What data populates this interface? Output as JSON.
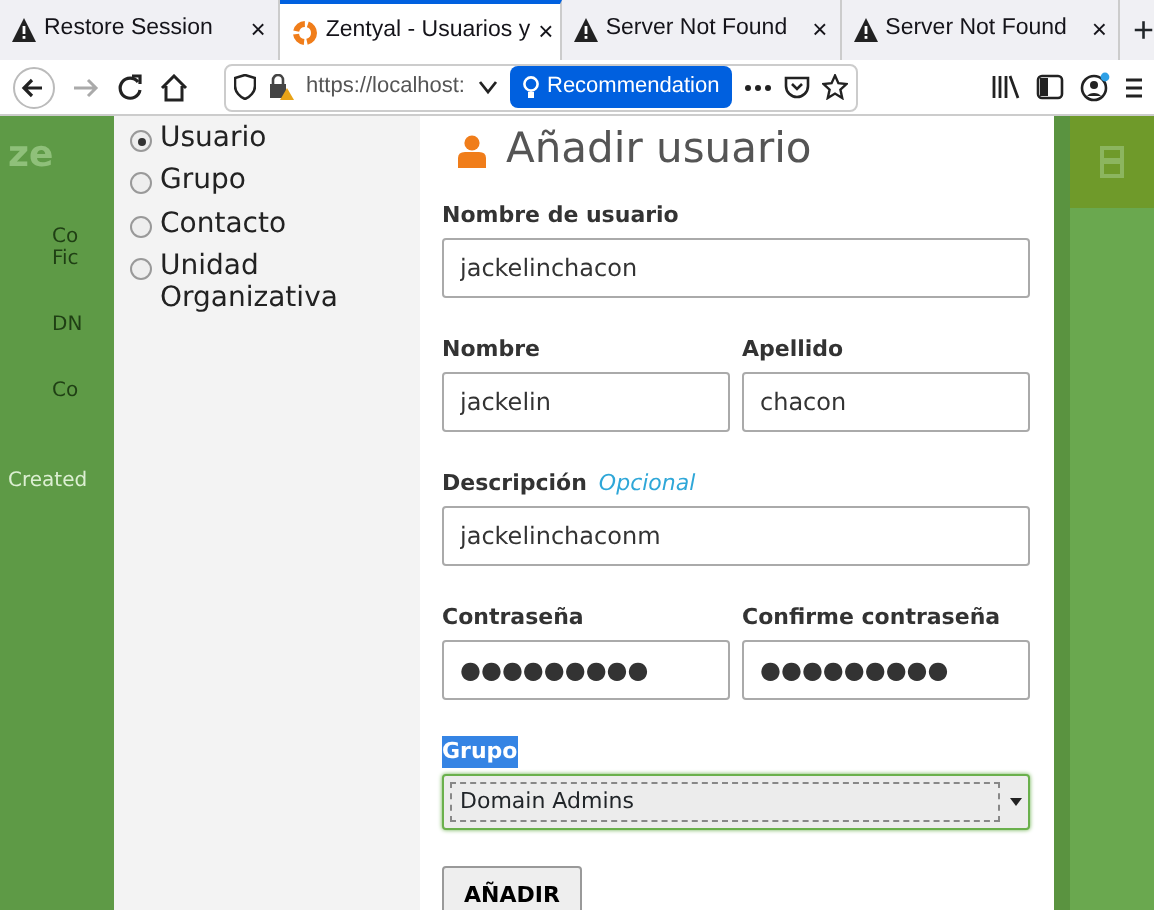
{
  "browser_tabs": [
    {
      "title": "Restore Session",
      "kind": "warning",
      "close": "×",
      "selected": false
    },
    {
      "title": "Zentyal - Usuarios y",
      "kind": "zentyal",
      "close": "×",
      "selected": true
    },
    {
      "title": "Server Not Found",
      "kind": "warning",
      "close": "×",
      "selected": false
    },
    {
      "title": "Server Not Found",
      "kind": "warning",
      "close": "×",
      "selected": false
    }
  ],
  "new_tab": "+",
  "address_bar": {
    "url": "https://localhost:",
    "recommendation": "Recommendation"
  },
  "forward_disabled": true,
  "background_sidebar": [
    {
      "text": "ze",
      "kind": "logo"
    },
    {
      "text": "Co\nFic",
      "kind": "item"
    },
    {
      "text": "DN",
      "kind": "item"
    },
    {
      "text": "Co",
      "kind": "item"
    },
    {
      "text": "Created",
      "kind": "footer"
    }
  ],
  "object_types": [
    {
      "label": "Usuario",
      "selected": true
    },
    {
      "label": "Grupo",
      "selected": false
    },
    {
      "label": "Contacto",
      "selected": false
    },
    {
      "label": "Unidad Organizativa",
      "selected": false
    }
  ],
  "form": {
    "title": "Añadir usuario",
    "rows": [
      [
        {
          "label": "Nombre de usuario",
          "value": "jackelinchacon"
        }
      ],
      [
        {
          "label": "Nombre",
          "value": "jackelin"
        },
        {
          "label": "Apellido",
          "value": "chacon"
        }
      ],
      [
        {
          "label": "Descripción",
          "hint": "Opcional",
          "value": "jackelinchaconm"
        }
      ],
      [
        {
          "label": "Contraseña",
          "value": "●●●●●●●●●"
        },
        {
          "label": "Confirme contraseña",
          "value": "●●●●●●●●●"
        }
      ]
    ],
    "group": {
      "label": "Grupo",
      "highlighted": true,
      "value": "Domain Admins",
      "focused": true
    },
    "submit": "AÑADIR"
  }
}
